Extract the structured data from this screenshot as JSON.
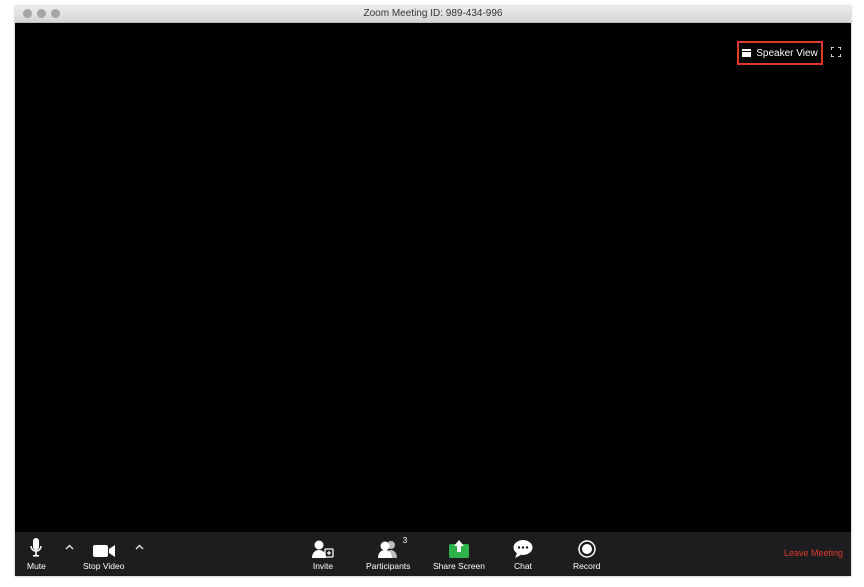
{
  "window": {
    "title": "Zoom Meeting ID: 989-434-996"
  },
  "top_controls": {
    "speaker_view_label": "Speaker View"
  },
  "toolbar": {
    "mute_label": "Mute",
    "stop_video_label": "Stop Video",
    "invite_label": "Invite",
    "participants_label": "Participants",
    "participants_count": "3",
    "share_screen_label": "Share Screen",
    "chat_label": "Chat",
    "record_label": "Record",
    "leave_label": "Leave Meeting"
  },
  "colors": {
    "leave": "#e0392b",
    "highlight_border": "#e0392b",
    "share_green": "#2db34a",
    "toolbar_bg": "#1d1d1f"
  }
}
